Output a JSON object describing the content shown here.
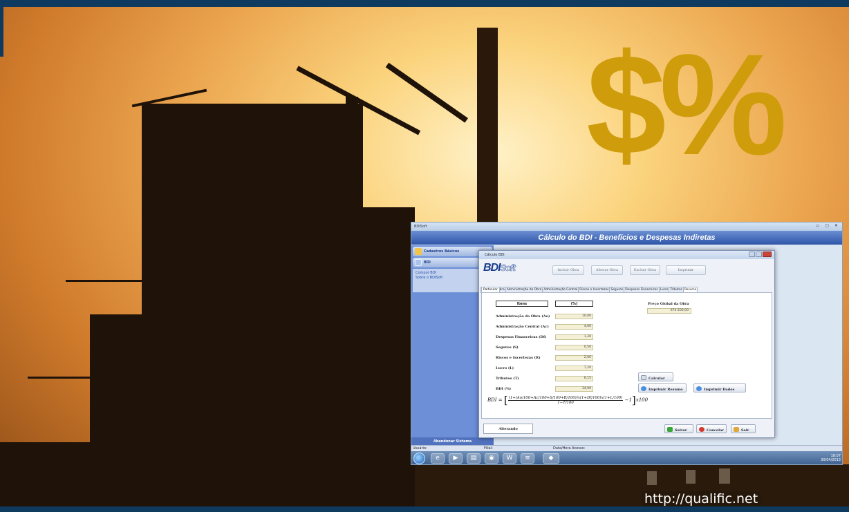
{
  "background": {
    "symbol": "$%",
    "url": "http://qualific.net",
    "accent_color": "#cf9c0b",
    "frame_color": "#0f3a5f"
  },
  "app": {
    "window_title": "BDISoft",
    "header_title": "Cálculo do BDI - Benefícios e Despesas Indiretas",
    "sidebar": {
      "groups": [
        {
          "label": "Cadastros Básicos",
          "icon": "folder-icon"
        },
        {
          "label": "BDI",
          "icon": "users-icon"
        }
      ],
      "links": [
        "Compor BDI",
        "Sobre o BDISoft"
      ],
      "exit_label": "Abandonar Sistema"
    },
    "status": {
      "user_label": "Usuário:",
      "branch_label": "Filial:",
      "datetime_label": "Data/Hora Acesso:"
    },
    "tray": {
      "time": "18:07",
      "date": "30/04/2013"
    }
  },
  "dialog": {
    "title": "Cálculo BDI",
    "logo": {
      "main": "BDI",
      "suffix": "Soft"
    },
    "toolbar": {
      "include": "Incluir Obra",
      "change": "Alterar Obra",
      "delete": "Excluir Obra",
      "print": "Imprimir"
    },
    "tabs": [
      "Dados da Obra",
      "Administração da Obra",
      "Administração Central",
      "Riscos e Incertezas",
      "Seguros",
      "Despesas Financeiras",
      "Lucro",
      "Tributos",
      "Resumo"
    ],
    "active_tab": "Resumo",
    "subtab": "Particular",
    "table": {
      "col_items": "Itens",
      "col_pct": "(%)",
      "rows": [
        {
          "label": "Administração da Obra (Ao)",
          "value": "10,00"
        },
        {
          "label": "Administração Central (Ac)",
          "value": "4,00"
        },
        {
          "label": "Despesas Financeiras (Df)",
          "value": "1,30"
        },
        {
          "label": "Seguros (S)",
          "value": "0,50"
        },
        {
          "label": "Riscos e Incertezas (R)",
          "value": "2,00"
        },
        {
          "label": "Lucro (L)",
          "value": "7,20"
        },
        {
          "label": "Tributos (T)",
          "value": "6,15"
        },
        {
          "label": "BDI (%)",
          "value": "34,90"
        }
      ]
    },
    "global_price": {
      "label": "Preço Global da Obra",
      "value": "674.500,00"
    },
    "buttons": {
      "calc": "Calcular",
      "print_summary": "Imprimir Resumo",
      "print_data": "Imprimir Dados",
      "save": "Salvar",
      "cancel": "Cancelar",
      "exit": "Sair"
    },
    "formula": {
      "lhs": "BDI =",
      "numerator": "(1+(Ao/100+Ac/100+S/100+R/100))x(1+Df/100)x(1+L/100)",
      "denominator": "1−T/100",
      "minus_one": "−1",
      "times_100": "x100"
    },
    "mode": "Alterando"
  }
}
